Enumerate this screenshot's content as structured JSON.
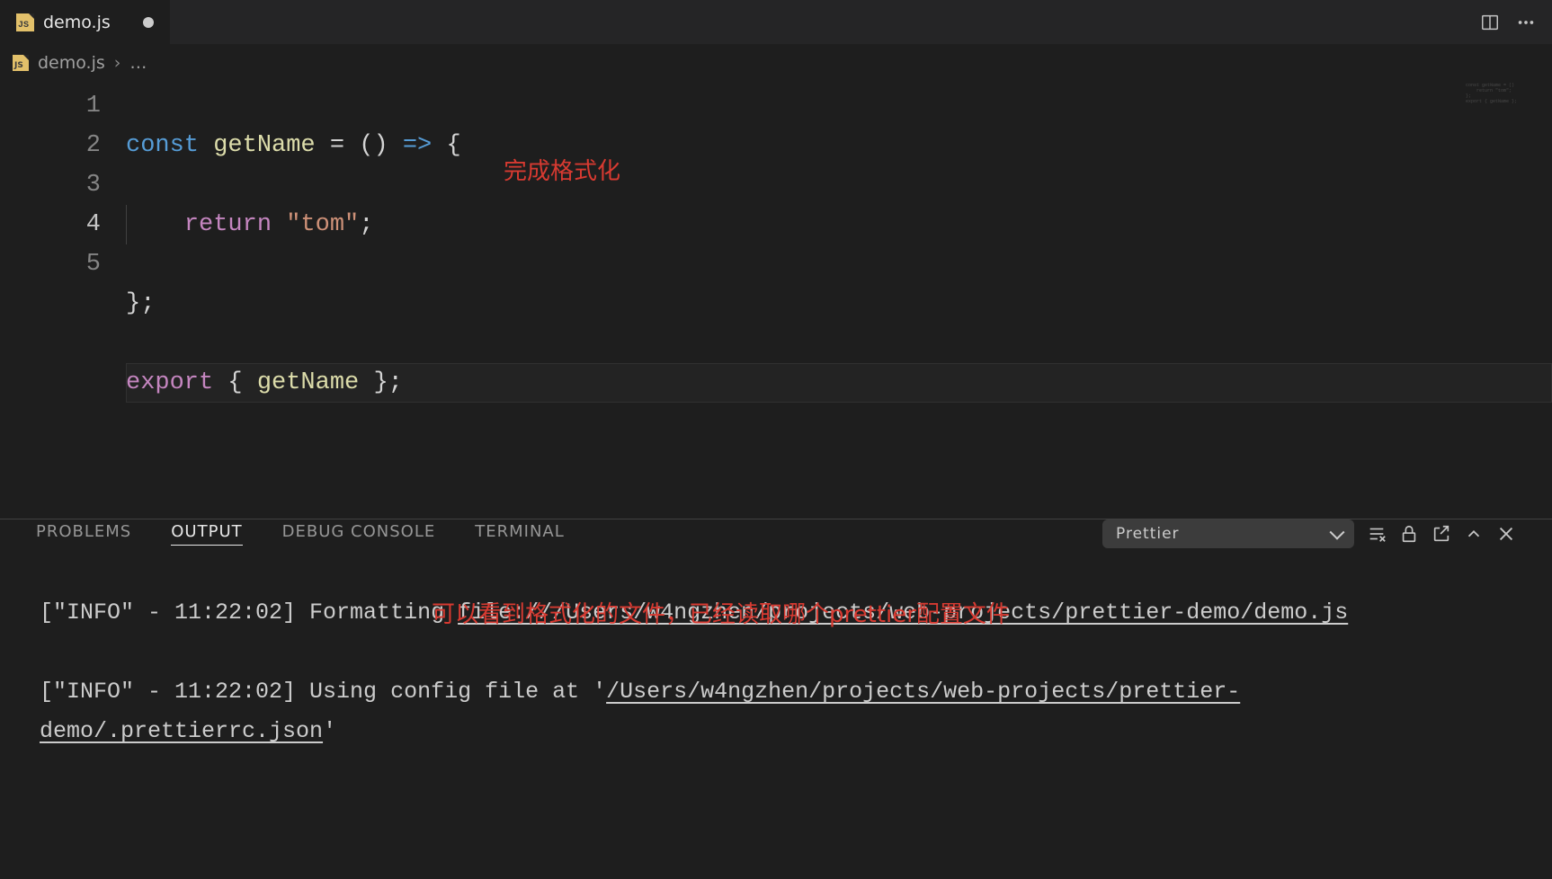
{
  "tab": {
    "filename": "demo.js",
    "dirty": true
  },
  "editor_actions": {
    "split": "split-editor",
    "more": "more"
  },
  "breadcrumb": {
    "filename": "demo.js",
    "rest": "…"
  },
  "code": {
    "lines": [
      {
        "n": "1"
      },
      {
        "n": "2"
      },
      {
        "n": "3"
      },
      {
        "n": "4"
      },
      {
        "n": "5"
      }
    ],
    "l1": {
      "const": "const",
      "sp": " ",
      "getName": "getName",
      "eq": " = ",
      "paren": "()",
      "arrow": " => ",
      "brace": "{"
    },
    "l2": {
      "indent": "    ",
      "return": "return",
      "sp": " ",
      "str": "\"tom\"",
      "semi": ";"
    },
    "l3": {
      "brace": "}",
      "semi": ";"
    },
    "l4": {
      "export": "export",
      "sp": " ",
      "lb": "{ ",
      "getName": "getName",
      "rb": " }",
      "semi": ";"
    }
  },
  "annotations": {
    "a1": "完成格式化",
    "a2": "可以看到格式化的文件，已经读取哪个prettier配置文件"
  },
  "panel": {
    "tabs": {
      "problems": "PROBLEMS",
      "output": "OUTPUT",
      "debug": "DEBUG CONSOLE",
      "terminal": "TERMINAL"
    },
    "channel": "Prettier"
  },
  "output": {
    "e1_prefix": "[\"INFO\" - 11:22:02] Formatting ",
    "e1_link": "file:///Users/w4ngzhen/projects/web-projects/prettier-demo/demo.js",
    "e2_prefix": "[\"INFO\" - 11:22:02] Using config file at '",
    "e2_link": "/Users/w4ngzhen/projects/web-projects/prettier-demo/.prettierrc.json",
    "e2_suffix": "'"
  }
}
